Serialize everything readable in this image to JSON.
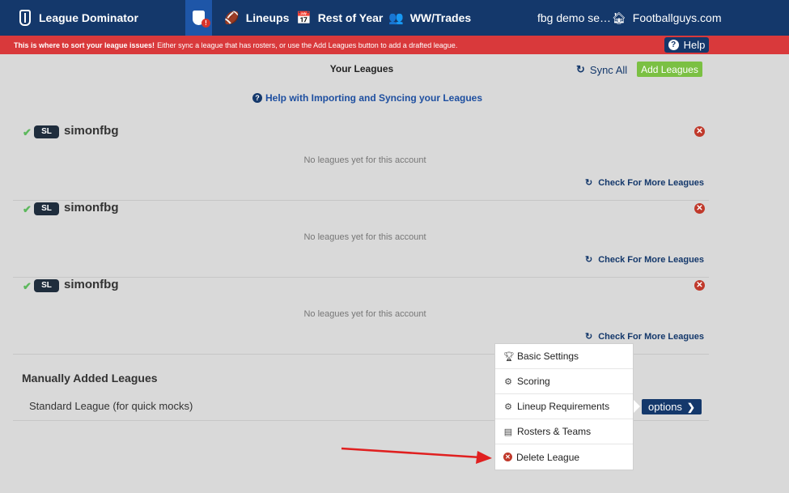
{
  "nav": {
    "brand": "League Dominator",
    "alert_badge": "!",
    "items": [
      {
        "label": "Lineups",
        "icon": "football-icon"
      },
      {
        "label": "Rest of Year",
        "icon": "calendar-icon"
      },
      {
        "label": "WW/Trades",
        "icon": "add-user-icon"
      }
    ],
    "account": "fbg demo se…",
    "site": "Footballguys.com"
  },
  "banner": {
    "bold": "This is where to sort your league issues!",
    "text": "Either sync a league that has rosters, or use the Add Leagues button to add a drafted league.",
    "help": "Help"
  },
  "main": {
    "title": "Your Leagues",
    "sync_all": "Sync All",
    "add_leagues": "Add Leagues",
    "import_help": "Help with Importing and Syncing your Leagues",
    "accounts": [
      {
        "badge": "SL",
        "name": "simonfbg",
        "empty": "No leagues yet for this account",
        "check_more": "Check For More Leagues"
      },
      {
        "badge": "SL",
        "name": "simonfbg",
        "empty": "No leagues yet for this account",
        "check_more": "Check For More Leagues"
      },
      {
        "badge": "SL",
        "name": "simonfbg",
        "empty": "No leagues yet for this account",
        "check_more": "Check For More Leagues"
      }
    ],
    "manual_title": "Manually Added Leagues",
    "manual_league": "Standard League (for quick mocks)",
    "options": "options"
  },
  "menu": {
    "items": [
      "Basic Settings",
      "Scoring",
      "Lineup Requirements",
      "Rosters & Teams",
      "Delete League"
    ]
  },
  "colors": {
    "nav": "#14386b",
    "banner": "#d9393b",
    "add": "#7bc043",
    "arrow": "#e02020"
  }
}
